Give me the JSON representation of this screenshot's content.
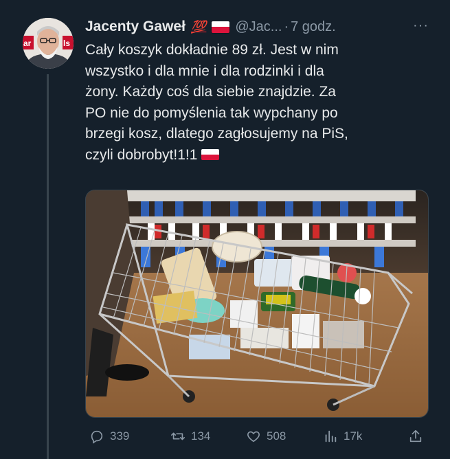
{
  "tweet": {
    "author_name": "Jacenty Gaweł",
    "hundred_emoji": "💯",
    "handle": "@Jac...",
    "separator": "·",
    "time": "7 godz.",
    "more": "···",
    "text_lines": [
      "Cały koszyk dokładnie 89 zł. Jest w nim",
      "wszystko i dla mnie i dla rodzinki i dla",
      "żony. Każdy coś dla siebie znajdzie. Za",
      "PO nie do pomyślenia tak wypchany po",
      "brzegi kosz, dlatego zagłosujemy na PiS,",
      "czyli dobrobyt!1!1"
    ],
    "avatar_text_left": "ar",
    "avatar_text_right": "ls",
    "media_alt": "Shopping cart full of groceries",
    "actions": {
      "replies": "339",
      "retweets": "134",
      "likes": "508",
      "views": "17k"
    }
  },
  "colors": {
    "background": "#15202b",
    "text": "#e7e9ea",
    "muted": "#8b98a5",
    "flag_red": "#dc143c"
  },
  "icons": [
    "reply-icon",
    "retweet-icon",
    "like-icon",
    "views-icon",
    "share-icon",
    "more-icon"
  ]
}
